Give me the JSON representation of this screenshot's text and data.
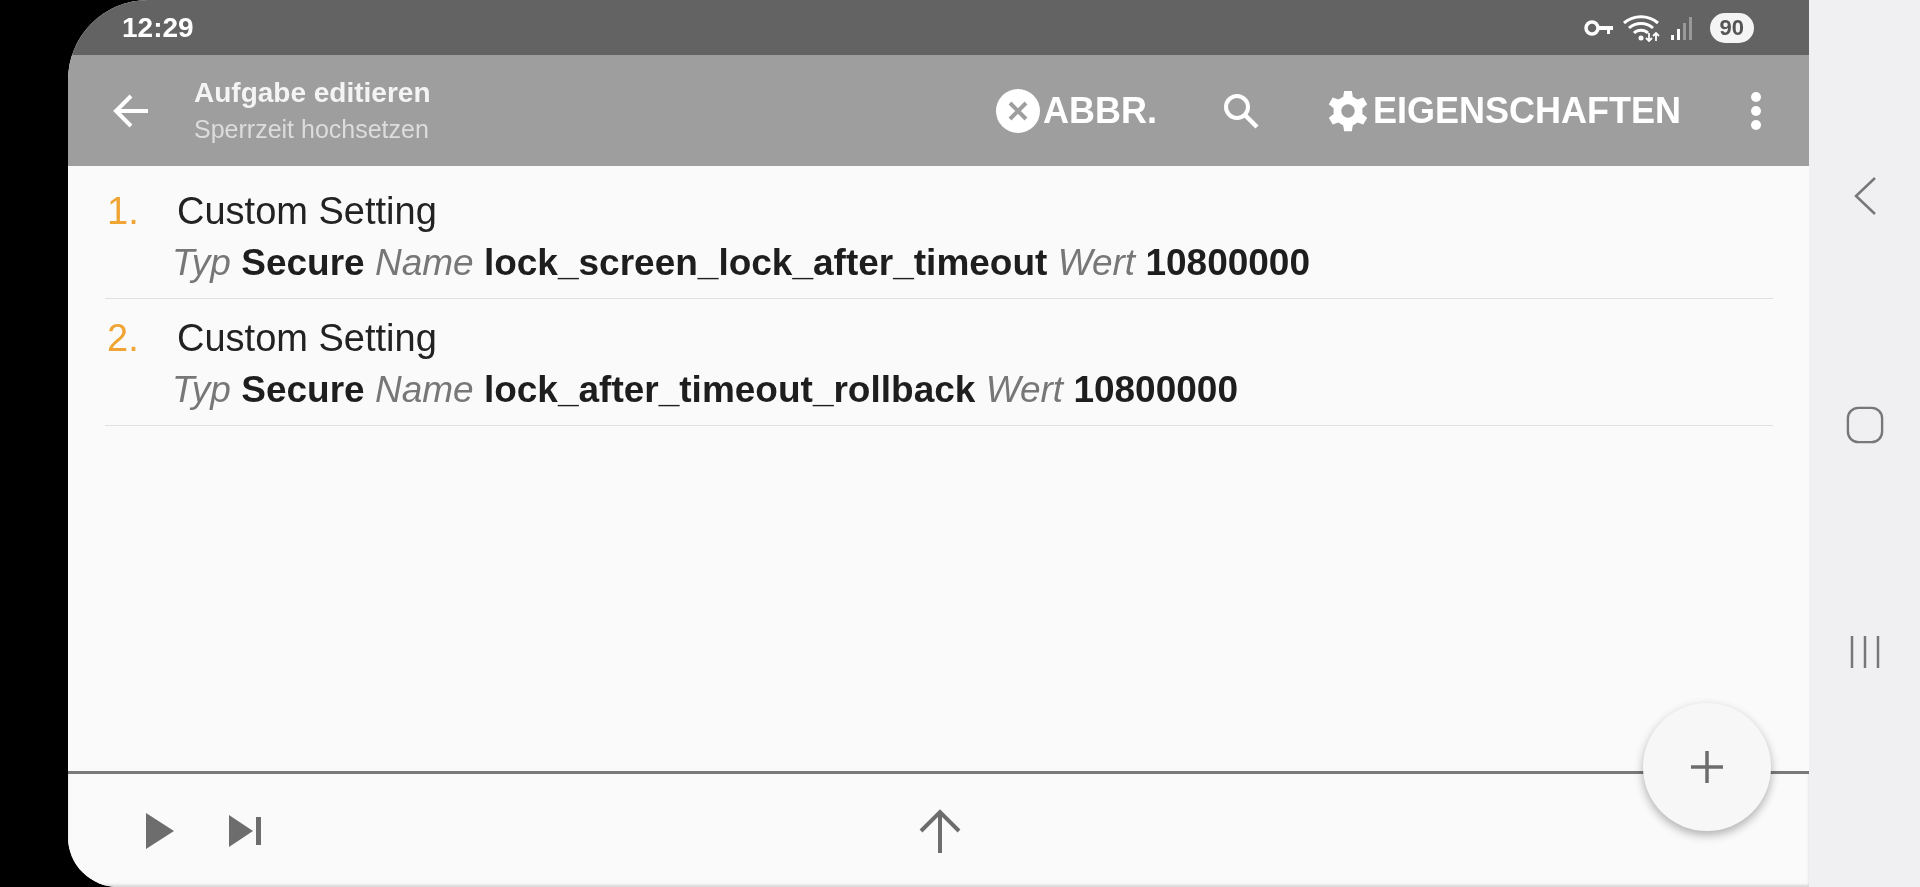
{
  "status_bar": {
    "time": "12:29",
    "battery": "90"
  },
  "app_bar": {
    "title": "Aufgabe editieren",
    "subtitle": "Sperrzeit hochsetzen",
    "actions": [
      {
        "kind": "cancel",
        "label": "ABBR."
      },
      {
        "kind": "search"
      },
      {
        "kind": "settings",
        "label": "EIGENSCHAFTEN"
      },
      {
        "kind": "more"
      }
    ]
  },
  "actions": [
    {
      "number": "1.",
      "title": "Custom Setting",
      "params": [
        {
          "label": "Typ",
          "value": "Secure"
        },
        {
          "label": "Name",
          "value": "lock_screen_lock_after_timeout"
        },
        {
          "label": "Wert",
          "value": "10800000"
        }
      ]
    },
    {
      "number": "2.",
      "title": "Custom Setting",
      "params": [
        {
          "label": "Typ",
          "value": "Secure"
        },
        {
          "label": "Name",
          "value": "lock_after_timeout_rollback"
        },
        {
          "label": "Wert",
          "value": "10800000"
        }
      ]
    }
  ]
}
